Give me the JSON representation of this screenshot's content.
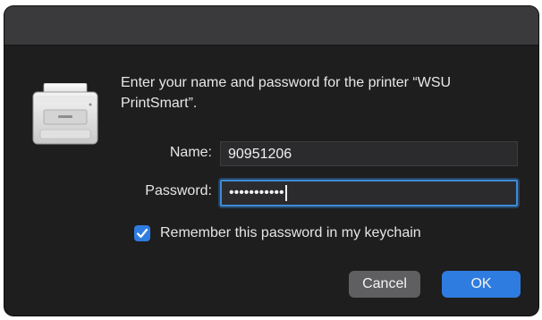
{
  "dialog": {
    "message": "Enter your name and password for the printer “WSU PrintSmart”.",
    "name_label": "Name:",
    "name_value": "90951206",
    "password_label": "Password:",
    "password_masked": "•••••••••••",
    "remember_label": "Remember this password in my keychain",
    "remember_checked": true,
    "cancel_label": "Cancel",
    "ok_label": "OK"
  },
  "colors": {
    "accent": "#2f7ce0",
    "background": "#1e1e1f",
    "titlebar": "#3a3a3c"
  },
  "icons": {
    "printer": "printer-icon",
    "checkmark": "checkmark-icon"
  }
}
